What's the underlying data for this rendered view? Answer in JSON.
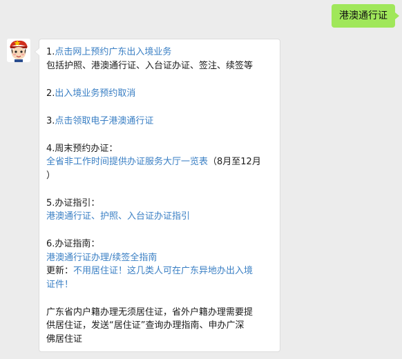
{
  "sent_message": "港澳通行证",
  "colors": {
    "sent_bubble": "#a0e75a",
    "link": "#3a7fc4",
    "background": "#ececec"
  },
  "reply": {
    "item1": {
      "num": "1.",
      "link": "点击网上预约广东出入境业务",
      "desc": "包括护照、港澳通行证、入台证办证、签注、续签等"
    },
    "item2": {
      "num": "2.",
      "link": "出入境业务预约取消"
    },
    "item3": {
      "num": "3.",
      "link": "点击领取电子港澳通行证"
    },
    "item4": {
      "label": "4.周末预约办证：",
      "link": "全省非工作时间提供办证服务大厅一览表",
      "note": "（8月至12月",
      "note_end": "）"
    },
    "item5": {
      "label": "5.办证指引：",
      "link": "港澳通行证、护照、入台证办证指引"
    },
    "item6": {
      "label": "6.办证指南：",
      "link": "港澳通行证办理/续签全指南",
      "update_label": "更新：",
      "update_link_1": "不用居住证！这几类人可在广东异地办出入境",
      "update_link_2": "证件！"
    },
    "footer_1": "广东省内户籍办理无须居住证，省外户籍办理需要提",
    "footer_2": "供居住证，发送“居住证”查询办理指南、申办广深",
    "footer_3": "佛居住证"
  }
}
